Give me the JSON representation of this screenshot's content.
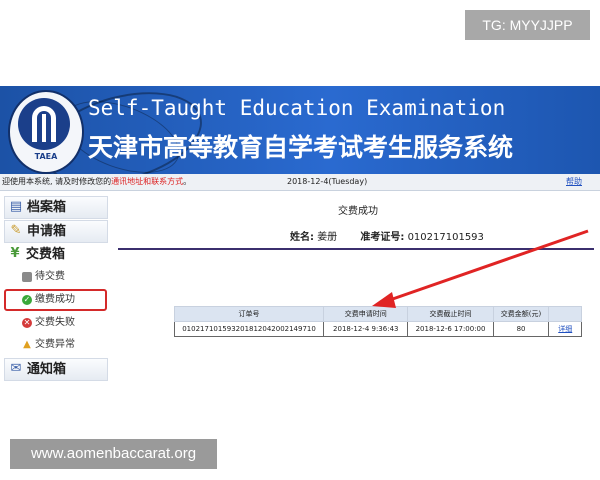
{
  "watermarks": {
    "top": "TG: MYYJJPP",
    "bottom": "www.aomenbaccarat.org"
  },
  "colors": {
    "banner": "#2a6ad0",
    "active_highlight": "#d42a2a",
    "link": "#2050c0",
    "rule": "#3b2f6e"
  },
  "header": {
    "logo_text": "TAEA",
    "title_en": "Self-Taught Education Examination",
    "title_cn": "天津市高等教育自学考试考生服务系统"
  },
  "infobar": {
    "notice_prefix": "迎使用本系统, 请及时修改您的",
    "notice_link": "通讯地址和联系方式",
    "notice_suffix": "。",
    "date": "2018-12-4(Tuesday)",
    "help": "帮助"
  },
  "sidebar": {
    "archive": {
      "label": "档案箱",
      "icon": "folder-icon"
    },
    "apply": {
      "label": "申请箱",
      "icon": "pen-icon"
    },
    "payment": {
      "label": "交费箱",
      "icon": "yen-icon"
    },
    "items": [
      {
        "label": "待交费",
        "icon": "pending-icon"
      },
      {
        "label": "缴费成功",
        "icon": "success-check-icon"
      },
      {
        "label": "交费失败",
        "icon": "fail-x-icon"
      },
      {
        "label": "交费异常",
        "icon": "warning-icon"
      }
    ],
    "notice": {
      "label": "通知箱",
      "icon": "envelope-icon"
    }
  },
  "main": {
    "title": "交费成功",
    "name_label": "姓名:",
    "name_value": "姜册",
    "id_label": "准考证号:",
    "id_value": "010217101593"
  },
  "table": {
    "headers": [
      "订单号",
      "交费申请时间",
      "交费截止时间",
      "交费金额(元)",
      ""
    ],
    "rows": [
      [
        "010217101593201812042002149710",
        "2018-12-4 9:36:43",
        "2018-12-6 17:00:00",
        "80",
        "详细"
      ]
    ]
  }
}
